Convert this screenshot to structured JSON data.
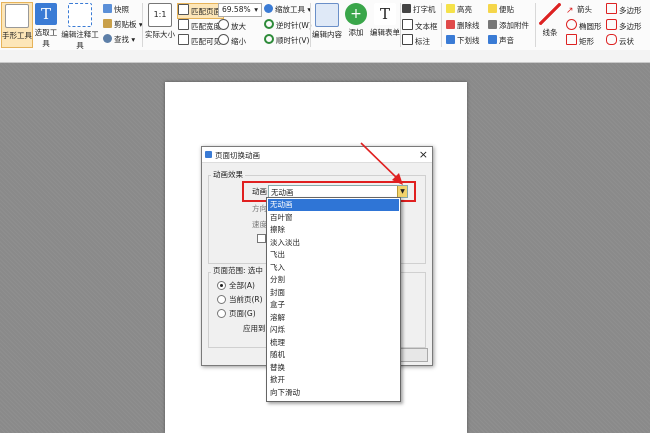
{
  "ribbon": {
    "hand_tool": "手形工具",
    "select_tool": "选取工具",
    "edit_annot_tool": "编辑注释工具",
    "snapshot": "快照",
    "clipboard": "剪贴板",
    "find": "查找",
    "actual_size": "实际大小",
    "fit_page": "匹配页面",
    "fit_width": "匹配宽度",
    "fit_visible": "匹配可见",
    "zoom_value": "69.58%",
    "zoom_in": "放大",
    "zoom_out": "缩小",
    "zoom_tool": "缩放工具",
    "rotate_ccw": "逆时针(W)",
    "rotate_cw": "顺时针(V)",
    "edit_content": "编辑内容",
    "add": "添加",
    "edit_form": "编辑表单",
    "typewriter": "打字机",
    "textbox": "文本框",
    "callout": "标注",
    "highlight": "高亮",
    "strikeout": "删除线",
    "underline": "下划线",
    "note": "便贴",
    "attach_file": "添加附件",
    "sound": "声音",
    "line": "线条",
    "arrow": "箭头",
    "ellipse": "椭圆形",
    "rectangle": "矩形",
    "polygon": "多边形",
    "polyline": "多边形",
    "cloud": "云状"
  },
  "dialog": {
    "title": "页面切换动画",
    "section_effect": "动画效果",
    "effect_label": "动画",
    "effect_value": "无动画",
    "direction_label": "方向",
    "speed_label": "速度",
    "section_range": "页面范围: 选中 1 页",
    "radio_all": "全部(A)",
    "radio_current": "当前页(R)",
    "radio_pages": "页面(G)",
    "apply_to": "应用到"
  },
  "dropdown": {
    "options": [
      "无动画",
      "百叶窗",
      "擦除",
      "淡入淡出",
      "飞出",
      "飞入",
      "分割",
      "封面",
      "盒子",
      "溶解",
      "闪烁",
      "梳理",
      "随机",
      "替换",
      "掀开",
      "向下滑动"
    ]
  }
}
